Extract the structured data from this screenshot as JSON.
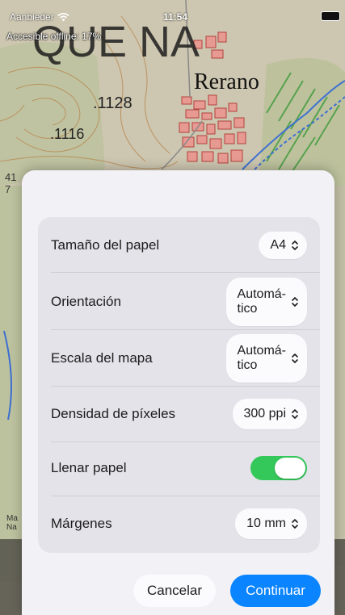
{
  "status_bar": {
    "carrier": "Aanbieder",
    "time": "11:54",
    "offline_text": "Accesible offline: 17%"
  },
  "map": {
    "place_name": "Rerano",
    "title_fragment": "QUE NA",
    "elevation_1": ".1128",
    "elevation_2": ".1116",
    "side_label_1": "41",
    "side_label_2": "7",
    "bottom_label_1": "Ma",
    "bottom_label_2": "Na"
  },
  "print_settings": {
    "rows": [
      {
        "label": "Tamaño del papel",
        "value": "A4"
      },
      {
        "label": "Orientación",
        "value_line1": "Automá-",
        "value_line2": "tico"
      },
      {
        "label": "Escala del mapa",
        "value_line1": "Automá-",
        "value_line2": "tico"
      },
      {
        "label": "Densidad de píxeles",
        "value": "300 ppi"
      },
      {
        "label": "Llenar papel",
        "toggle_on": true
      },
      {
        "label": "Márgenes",
        "value": "10 mm"
      }
    ]
  },
  "actions": {
    "cancel": "Cancelar",
    "continue": "Continuar"
  },
  "colors": {
    "accent": "#0a84ff",
    "toggle_on": "#34c759"
  }
}
